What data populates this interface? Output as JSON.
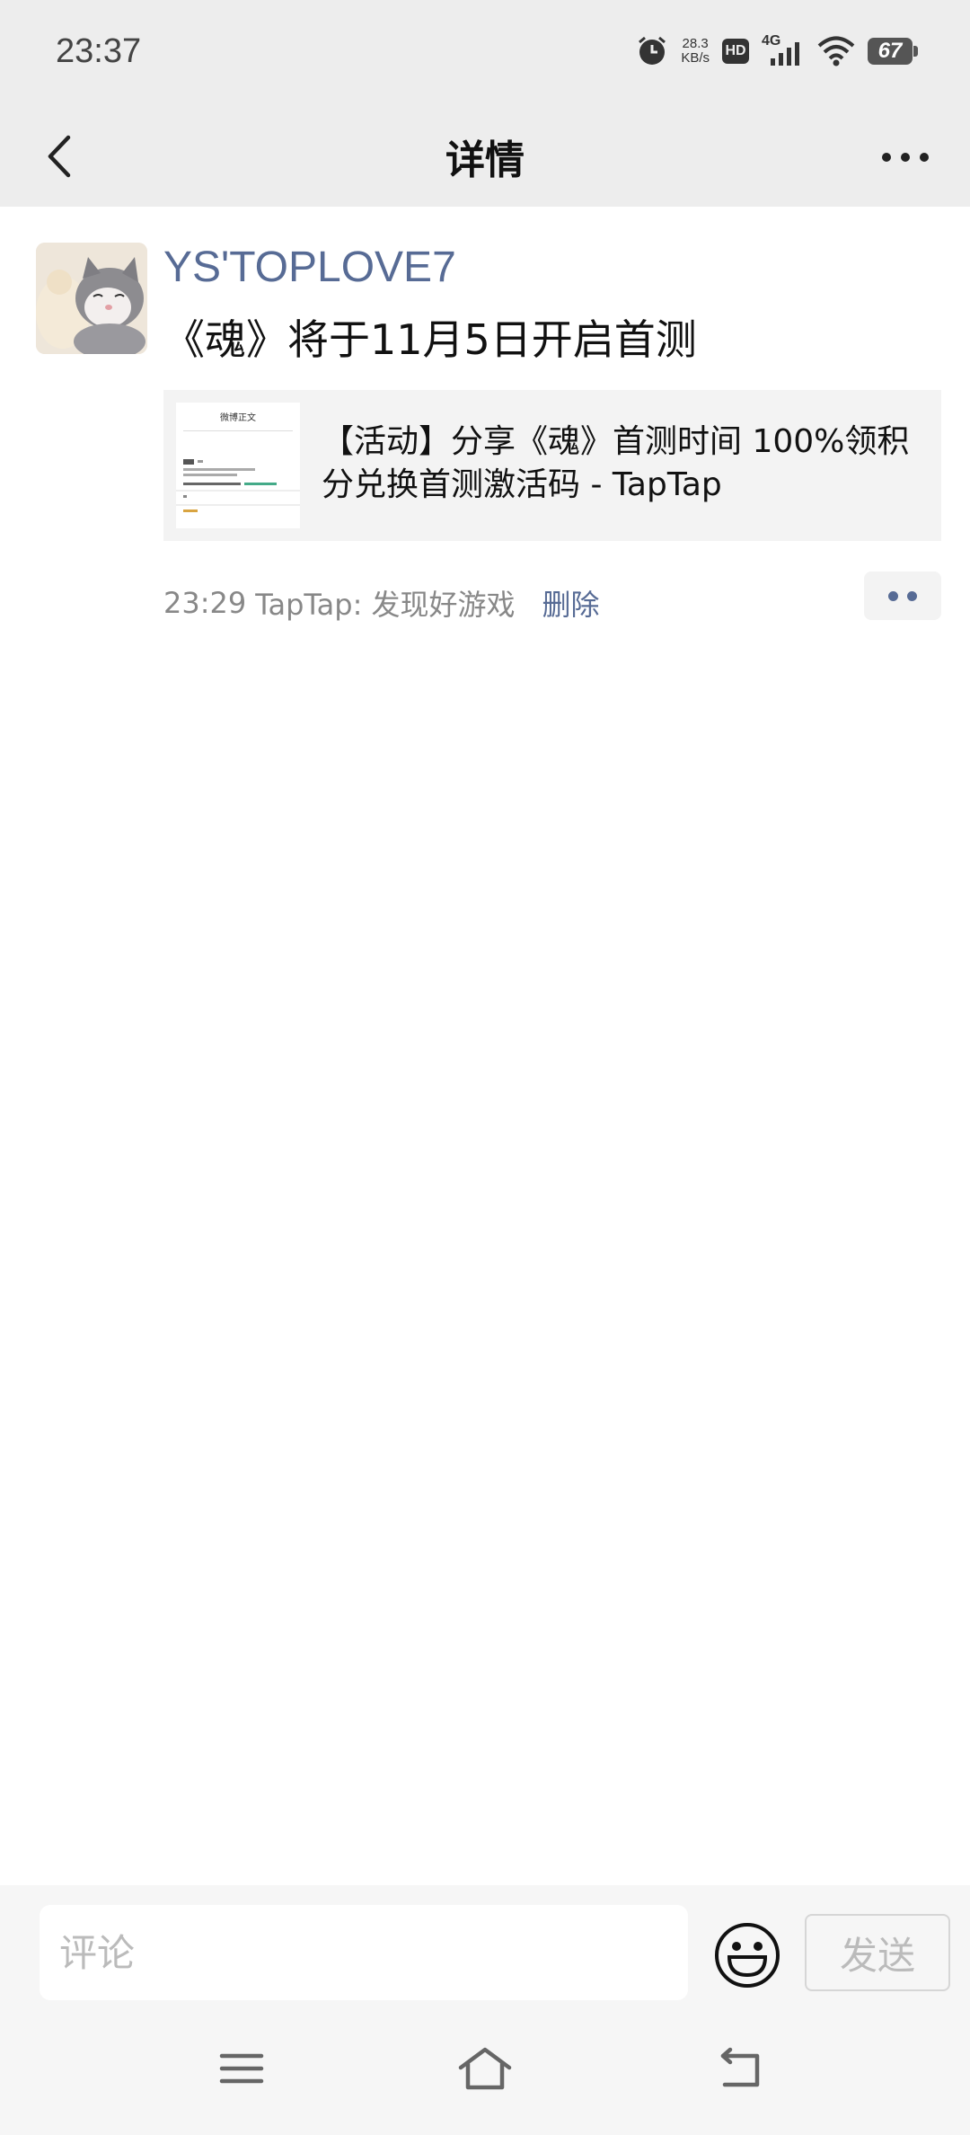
{
  "status_bar": {
    "time": "23:37",
    "net_speed_value": "28.3",
    "net_speed_unit": "KB/s",
    "hd_label": "HD",
    "network_label": "4G",
    "battery": "67",
    "icons": [
      "alarm-icon",
      "hd-icon",
      "signal-icon",
      "wifi-icon",
      "battery-icon"
    ]
  },
  "nav": {
    "title": "详情",
    "back_icon": "chevron-left-icon",
    "more_icon": "more-dots-icon"
  },
  "post": {
    "author": "YS'TOPLOVE7",
    "text": "《魂》将于11月5日开启首测",
    "link_card": {
      "title": "【活动】分享《魂》首测时间 100%领积分兑换首测激活码 - TapTap",
      "thumb_heading": "微博正文"
    },
    "time": "23:29",
    "source": "TapTap: 发现好游戏",
    "delete_label": "删除"
  },
  "comment_bar": {
    "placeholder": "评论",
    "send_label": "发送",
    "emoji_icon": "smiley-icon"
  },
  "system_nav": {
    "icons": [
      "menu-icon",
      "home-icon",
      "back-icon"
    ]
  },
  "colors": {
    "link_blue": "#576b95",
    "header_bg": "#ededed"
  }
}
